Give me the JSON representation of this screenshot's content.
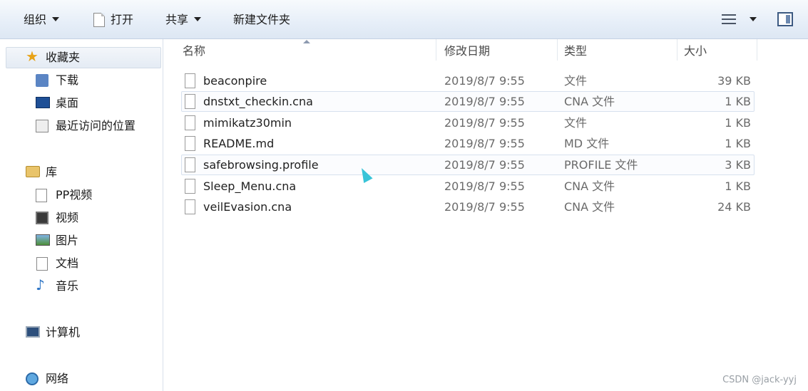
{
  "toolbar": {
    "organize": "组织",
    "open": "打开",
    "share": "共享",
    "new_folder": "新建文件夹"
  },
  "sidebar": {
    "favorites": {
      "title": "收藏夹",
      "items": [
        "下载",
        "桌面",
        "最近访问的位置"
      ]
    },
    "libraries": {
      "title": "库",
      "items": [
        "PP视频",
        "视频",
        "图片",
        "文档",
        "音乐"
      ]
    },
    "computer": "计算机",
    "network": "网络"
  },
  "columns": {
    "name": "名称",
    "modified": "修改日期",
    "type": "类型",
    "size": "大小"
  },
  "files": [
    {
      "name": "beaconpire",
      "modified": "2019/8/7 9:55",
      "type": "文件",
      "size": "39 KB"
    },
    {
      "name": "dnstxt_checkin.cna",
      "modified": "2019/8/7 9:55",
      "type": "CNA 文件",
      "size": "1 KB"
    },
    {
      "name": "mimikatz30min",
      "modified": "2019/8/7 9:55",
      "type": "文件",
      "size": "1 KB"
    },
    {
      "name": "README.md",
      "modified": "2019/8/7 9:55",
      "type": "MD 文件",
      "size": "1 KB"
    },
    {
      "name": "safebrowsing.profile",
      "modified": "2019/8/7 9:55",
      "type": "PROFILE 文件",
      "size": "3 KB"
    },
    {
      "name": "Sleep_Menu.cna",
      "modified": "2019/8/7 9:55",
      "type": "CNA 文件",
      "size": "1 KB"
    },
    {
      "name": "veilEvasion.cna",
      "modified": "2019/8/7 9:55",
      "type": "CNA 文件",
      "size": "24 KB"
    }
  ],
  "watermark": "CSDN @jack-yyj",
  "colors": {
    "toolbar_top": "#f7fafd",
    "toolbar_bottom": "#dde7f3",
    "hover_border": "#d7e1ee",
    "cursor": "#38c4d8"
  }
}
